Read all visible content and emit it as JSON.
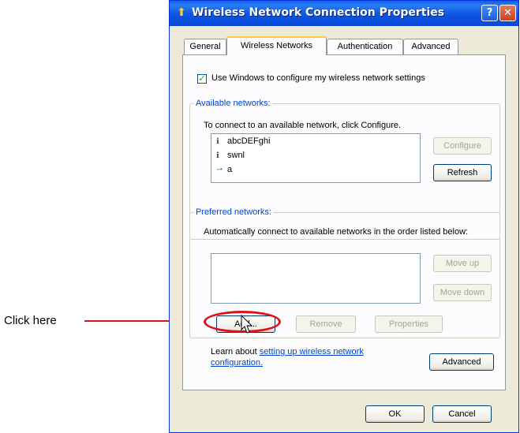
{
  "annotation": {
    "label": "Click  here",
    "color": "#e0101a"
  },
  "window": {
    "title": "Wireless Network Connection Properties",
    "help_button": "?",
    "close_button": "✕",
    "title_icon": "network-icon"
  },
  "tabs": [
    {
      "label": "General"
    },
    {
      "label": "Wireless Networks",
      "active": true
    },
    {
      "label": "Authentication"
    },
    {
      "label": "Advanced"
    }
  ],
  "use_windows_checkbox": {
    "label": "Use Windows to configure my wireless network settings",
    "checked": true
  },
  "available_networks": {
    "legend": "Available networks:",
    "description": "To connect to an available network, click Configure.",
    "items": [
      {
        "name": "abcDEFghi",
        "icon": "info-icon"
      },
      {
        "name": "swnl",
        "icon": "info-icon"
      },
      {
        "name": "a",
        "icon": "adhoc-network-icon"
      }
    ],
    "configure_label": "Configure",
    "refresh_label": "Refresh"
  },
  "preferred_networks": {
    "legend": "Preferred networks:",
    "description": "Automatically connect to available networks in the order listed below:",
    "move_up_label": "Move up",
    "move_down_label": "Move down",
    "add_label": "Add...",
    "remove_label": "Remove",
    "properties_label": "Properties"
  },
  "learn": {
    "prefix": "Learn about ",
    "link_text": "setting up wireless network configuration."
  },
  "advanced_label": "Advanced",
  "ok_label": "OK",
  "cancel_label": "Cancel"
}
